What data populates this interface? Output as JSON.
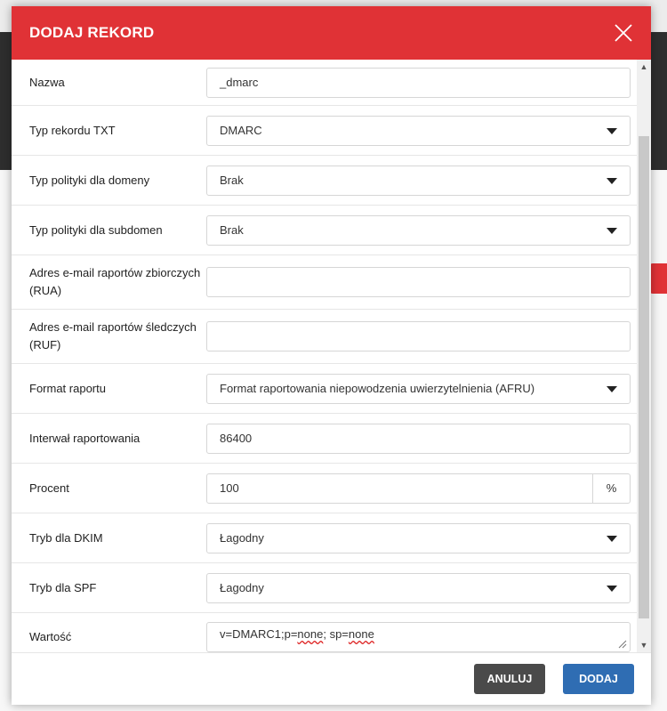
{
  "modal": {
    "title": "DODAJ REKORD"
  },
  "form": {
    "name": {
      "label": "Nazwa",
      "value": "_dmarc"
    },
    "record_type": {
      "label": "Typ rekordu TXT",
      "value": "DMARC"
    },
    "domain_policy": {
      "label": "Typ polityki dla domeny",
      "value": "Brak"
    },
    "subdomain_policy": {
      "label": "Typ polityki dla subdomen",
      "value": "Brak"
    },
    "rua": {
      "label_line1": "Adres e-mail raportów zbiorczych",
      "label_line2": "(RUA)",
      "value": ""
    },
    "ruf": {
      "label_line1": "Adres e-mail raportów śledczych",
      "label_line2": "(RUF)",
      "value": ""
    },
    "report_format": {
      "label": "Format raportu",
      "value": "Format raportowania niepowodzenia uwierzytelnienia (AFRU)"
    },
    "report_interval": {
      "label": "Interwał raportowania",
      "value": "86400"
    },
    "percent": {
      "label": "Procent",
      "value": "100",
      "addon": "%"
    },
    "dkim_mode": {
      "label": "Tryb dla DKIM",
      "value": "Łagodny"
    },
    "spf_mode": {
      "label": "Tryb dla SPF",
      "value": "Łagodny"
    },
    "value": {
      "label": "Wartość",
      "text_a": "v=DMARC1;p=",
      "text_b": "none",
      "text_c": "; sp=",
      "text_d": "none"
    }
  },
  "footer": {
    "cancel_label": "ANULUJ",
    "add_label": "DODAJ"
  }
}
